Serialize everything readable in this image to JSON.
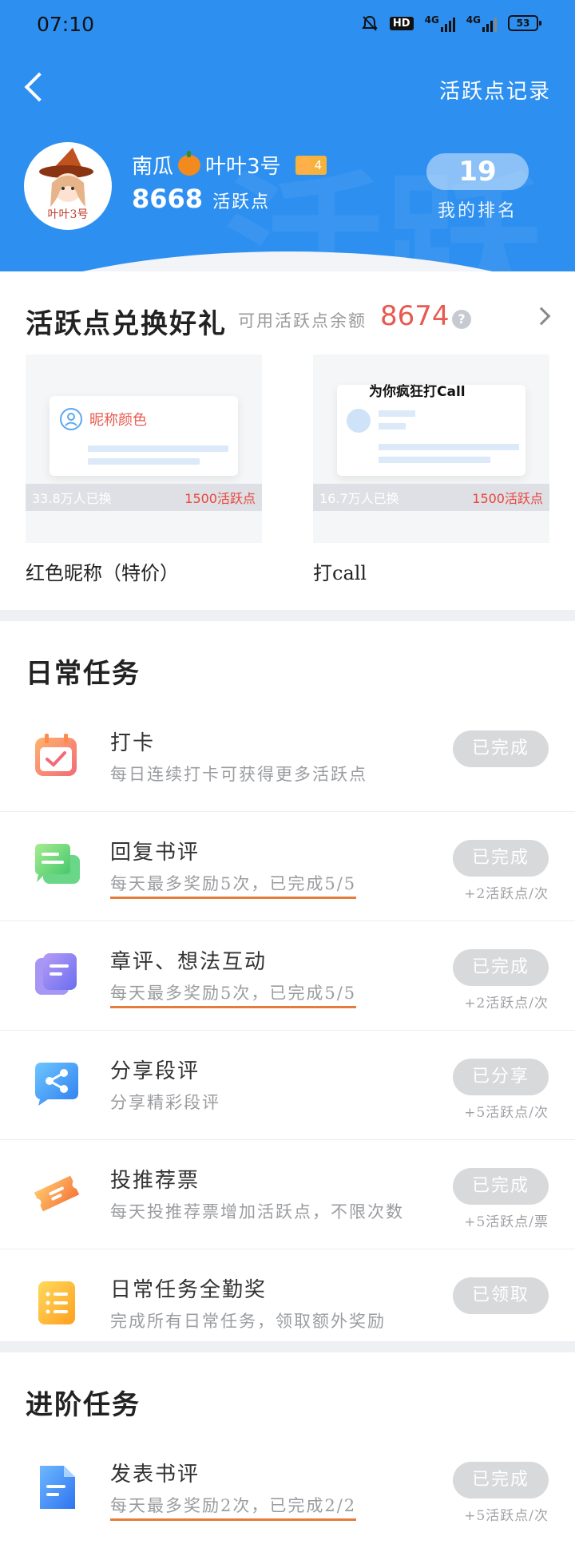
{
  "status_bar": {
    "time": "07:10",
    "hd_label": "HD",
    "network_1": "4G",
    "network_2": "4G",
    "battery": "53"
  },
  "header": {
    "record_link": "活跃点记录",
    "username": "南瓜",
    "username_suffix": "叶叶3号",
    "level": "4",
    "points": "8668",
    "points_unit": "活跃点",
    "rank": "19",
    "rank_label": "我的排名",
    "avatar_text": "叶叶3号"
  },
  "exchange": {
    "title": "活跃点兑换好礼",
    "balance_label": "可用活跃点余额",
    "balance": "8674",
    "help": "?",
    "gifts": [
      {
        "name": "红色昵称（特价）",
        "preview": "昵称颜色",
        "count": "33.8万人已换",
        "cost": "1500活跃点"
      },
      {
        "name": "打call",
        "preview": "为你疯狂打Call",
        "count": "16.7万人已换",
        "cost": "1500活跃点"
      }
    ]
  },
  "daily": {
    "title": "日常任务",
    "tasks": [
      {
        "name": "打卡",
        "desc": "每日连续打卡可获得更多活跃点",
        "button": "已完成",
        "reward": "",
        "icon": "calendar-check-icon"
      },
      {
        "name": "回复书评",
        "desc": "每天最多奖励5次，已完成5/5",
        "button": "已完成",
        "reward": "+2活跃点/次",
        "icon": "chat-bubble-icon"
      },
      {
        "name": "章评、想法互动",
        "desc": "每天最多奖励5次，已完成5/5",
        "button": "已完成",
        "reward": "+2活跃点/次",
        "icon": "note-stack-icon"
      },
      {
        "name": "分享段评",
        "desc": "分享精彩段评",
        "button": "已分享",
        "reward": "+5活跃点/次",
        "icon": "share-icon"
      },
      {
        "name": "投推荐票",
        "desc": "每天投推荐票增加活跃点，不限次数",
        "button": "已完成",
        "reward": "+5活跃点/票",
        "icon": "ticket-icon"
      },
      {
        "name": "日常任务全勤奖",
        "desc": "完成所有日常任务，领取额外奖励",
        "button": "已领取",
        "reward": "",
        "icon": "checklist-icon"
      }
    ]
  },
  "advanced": {
    "title": "进阶任务",
    "tasks": [
      {
        "name": "发表书评",
        "desc": "每天最多奖励2次，已完成2/2",
        "button": "已完成",
        "reward": "+5活跃点/次",
        "icon": "document-icon"
      }
    ]
  },
  "colors": {
    "header_blue": "#2d8ff0",
    "balance_red": "#e85a50",
    "underline_orange": "#e67c3a",
    "button_grey": "#d8d9db"
  }
}
